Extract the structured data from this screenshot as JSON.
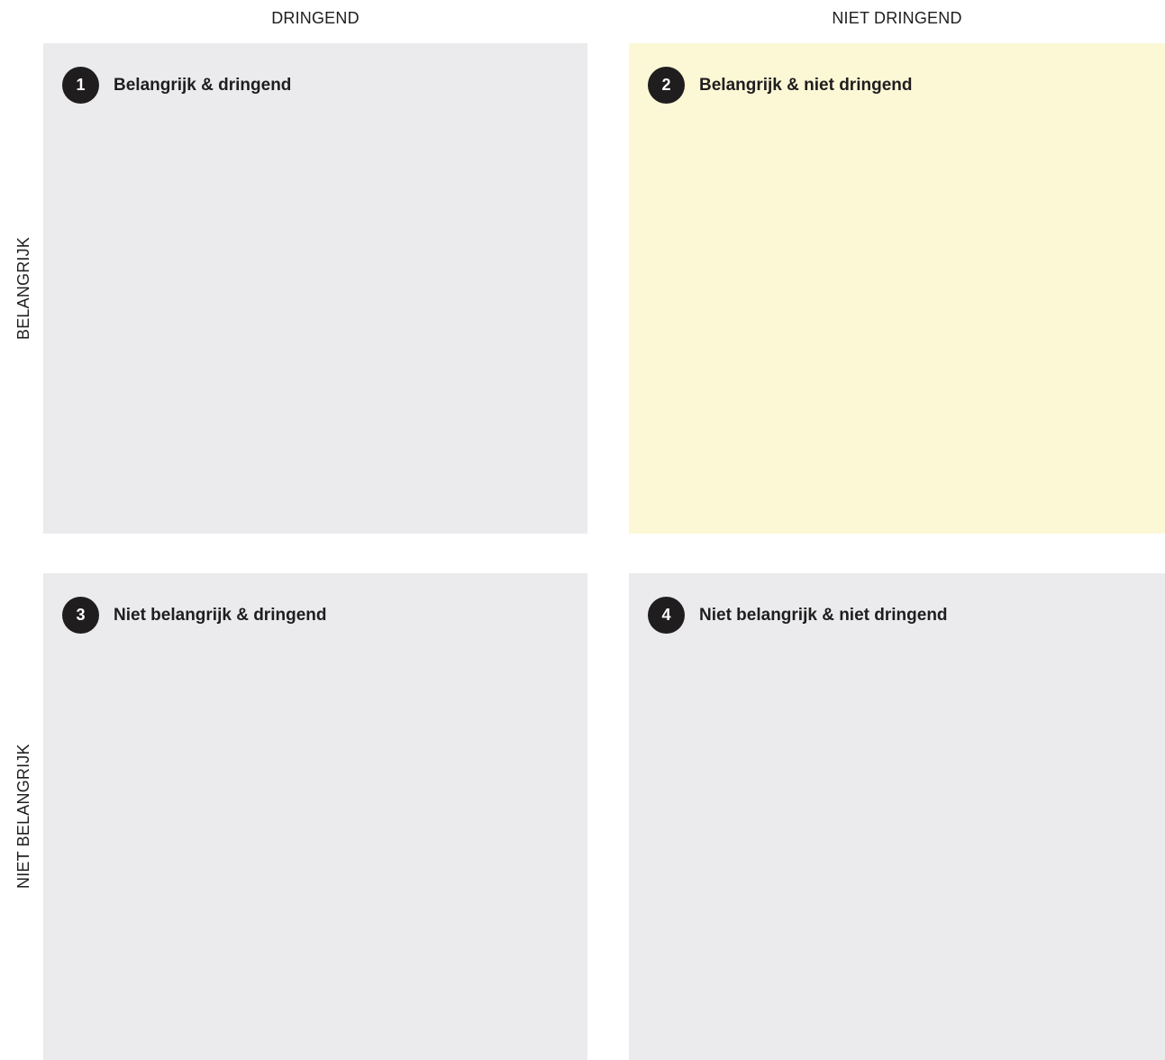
{
  "columns": {
    "left": "DRINGEND",
    "right": "NIET DRINGEND"
  },
  "rows": {
    "top": "BELANGRIJK",
    "bottom": "NIET BELANGRIJK"
  },
  "quadrants": [
    {
      "number": "1",
      "title": "Belangrijk & dringend",
      "color": "#ebebed"
    },
    {
      "number": "2",
      "title": "Belangrijk & niet dringend",
      "color": "#fcf8d6"
    },
    {
      "number": "3",
      "title": "Niet belangrijk & dringend",
      "color": "#ebebed"
    },
    {
      "number": "4",
      "title": "Niet belangrijk & niet dringend",
      "color": "#ebebed"
    }
  ],
  "colors": {
    "badge": "#1f1d1e",
    "text": "#1f1d1e",
    "background": "#ffffff"
  }
}
